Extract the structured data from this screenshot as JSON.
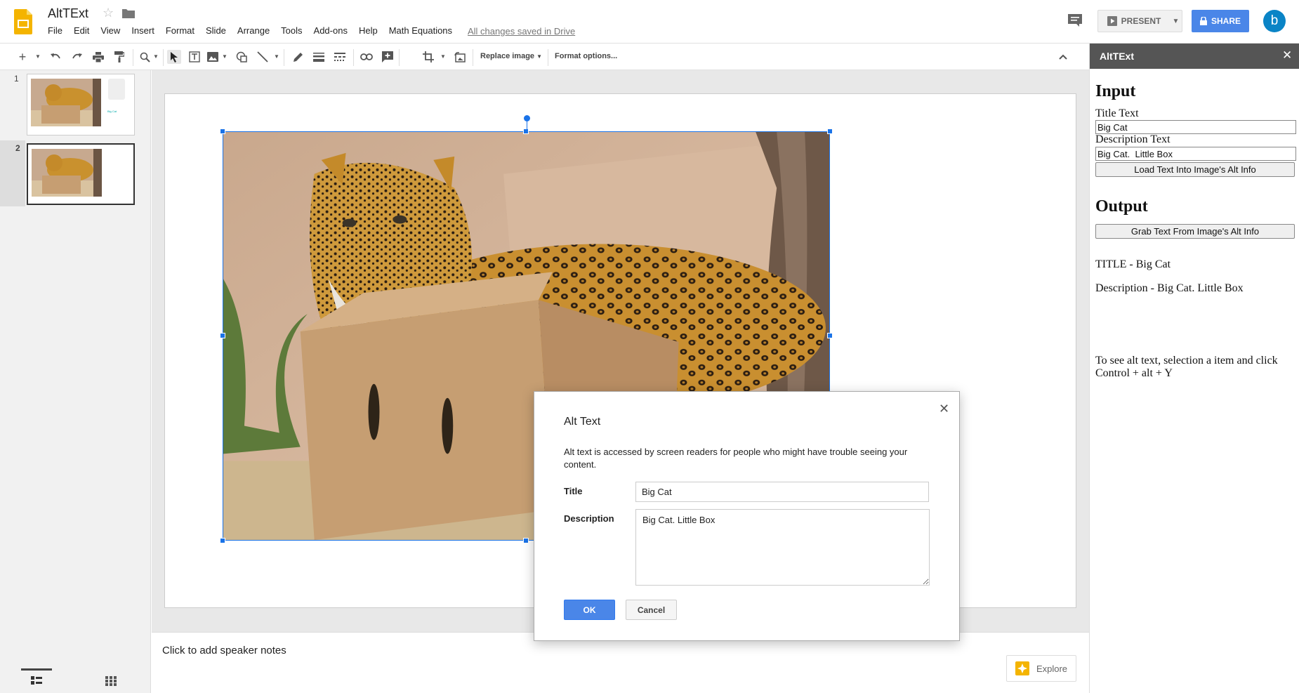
{
  "app": {
    "doc_title": "AltTExt",
    "save_status": "All changes saved in Drive",
    "present_label": "PRESENT",
    "share_label": "SHARE",
    "avatar_letter": "b"
  },
  "menu": [
    "File",
    "Edit",
    "View",
    "Insert",
    "Format",
    "Slide",
    "Arrange",
    "Tools",
    "Add-ons",
    "Help",
    "Math Equations"
  ],
  "toolbar": {
    "replace_image_label": "Replace image",
    "format_options_label": "Format options..."
  },
  "filmstrip": {
    "slides": [
      {
        "number": "1"
      },
      {
        "number": "2"
      }
    ],
    "thumb1_text": "Big Cat"
  },
  "notes": {
    "placeholder": "Click to add speaker notes",
    "explore_label": "Explore"
  },
  "dialog": {
    "title": "Alt Text",
    "description": "Alt text is accessed by screen readers for people who might have trouble seeing your content.",
    "title_label": "Title",
    "title_value": "Big Cat",
    "description_label": "Description",
    "description_value": "Big Cat. Little Box",
    "ok_label": "OK",
    "cancel_label": "Cancel"
  },
  "sidebar": {
    "title": "AltTExt",
    "input_heading": "Input",
    "title_text_label": "Title Text",
    "title_text_value": "Big Cat",
    "description_text_label": "Description Text",
    "description_text_value": "Big Cat.  Little Box",
    "load_button": "Load Text Into Image's Alt Info",
    "output_heading": "Output",
    "grab_button": "Grab Text From Image's Alt Info",
    "output_title": "TITLE - Big Cat",
    "output_description": "Description - Big Cat. Little Box",
    "help_text": "To see alt text, selection a item and click Control + alt + Y"
  },
  "colors": {
    "accent_blue": "#4a86e8",
    "selection_blue": "#1a73e8",
    "sidebar_header": "#555555",
    "slides_yellow": "#f4b400"
  }
}
